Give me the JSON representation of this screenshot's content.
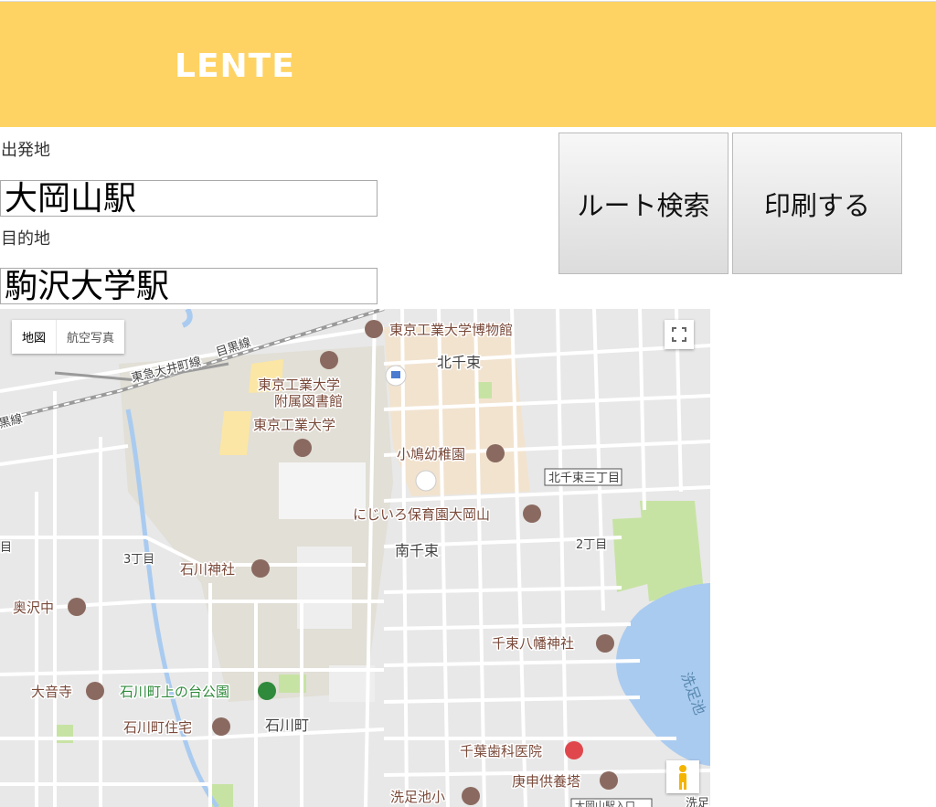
{
  "header": {
    "logo": "LENTE",
    "bg_color": "#ffd363"
  },
  "form": {
    "origin_label": "出発地",
    "origin_value": "大岡山駅",
    "destination_label": "目的地",
    "destination_value": "駒沢大学駅"
  },
  "actions": {
    "route_search": "ルート検索",
    "print": "印刷する"
  },
  "map": {
    "type_map": "地図",
    "type_aerial": "航空写真",
    "labels": {
      "museum": "東京工業大学博物館",
      "kitasenzoku": "北千束",
      "library_1": "東京工業大学",
      "library_2": "附属図書館",
      "university": "東京工業大学",
      "oimachi_line": "東急大井町線",
      "meguro_line": "目黒線",
      "meguro_line_2": "黒線",
      "kobato": "小鳩幼稚園",
      "kitasenzoku3": "北千束三丁目",
      "nijiiro": "にじいろ保育園大岡山",
      "minamisenzoku": "南千束",
      "chome2": "2丁目",
      "chome3": "3丁目",
      "ishikawa_shrine": "石川神社",
      "okusawa": "奥沢中",
      "senzoku_hachiman": "千束八幡神社",
      "senzokuike": "洗足池",
      "daionji": "大音寺",
      "ishikawa_park": "石川町上の台公園",
      "ishikawa_housing": "石川町住宅",
      "ishikawamachi": "石川町",
      "chiba_dental": "千葉歯科医院",
      "koshin": "庚申供養塔",
      "senzokuike_sho": "洗足池小",
      "ookayama_entrance": "大岡山駅入口",
      "edge_e": "目",
      "edge_senzoku": "洗足"
    }
  }
}
